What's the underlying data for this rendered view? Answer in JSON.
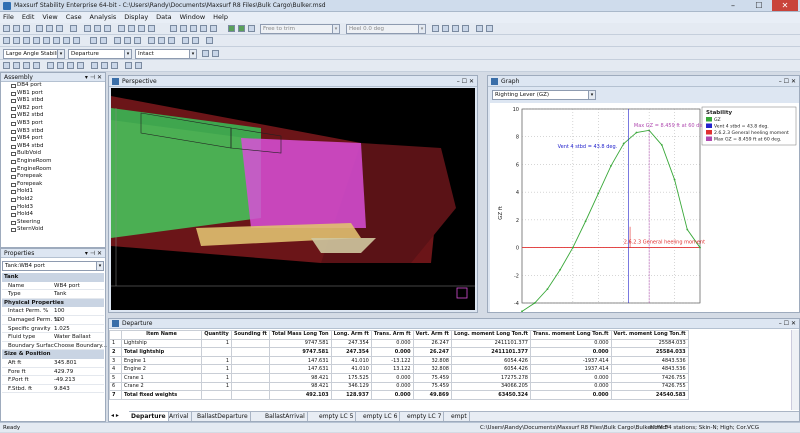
{
  "window": {
    "title": "Maxsurf Stability Enterprise 64-bit - C:\\Users\\Randy\\Documents\\Maxsurf R8 Files\\Bulk Cargo\\Bulker.msd",
    "min": "–",
    "max": "☐",
    "close": "✕"
  },
  "menu": [
    "File",
    "Edit",
    "View",
    "Case",
    "Analysis",
    "Display",
    "Data",
    "Window",
    "Help"
  ],
  "toolbar": {
    "free_to_trim": "Free to trim",
    "heel": "Heel 0.0 deg",
    "analysis_type": "Large Angle Stabili",
    "loadcase": "Departure",
    "condition": "Intact"
  },
  "assembly": {
    "title": "Assembly",
    "items": [
      "DB4 port",
      "WB1 port",
      "WB1 stbd",
      "WB2 port",
      "WB2 stbd",
      "WB3 port",
      "WB3 stbd",
      "WB4 port",
      "WB4 stbd",
      "BulbVoid",
      "EngineRoom",
      "EngineRoom",
      "Forepeak",
      "Forepeak",
      "Hold1",
      "Hold2",
      "Hold3",
      "Hold4",
      "Steering",
      "SternVoid"
    ]
  },
  "properties": {
    "title": "Properties",
    "selector": "Tank:WB4 port",
    "sections": [
      {
        "name": "Tank",
        "rows": [
          [
            "Name",
            "WB4 port"
          ],
          [
            "Type",
            "Tank"
          ]
        ]
      },
      {
        "name": "Physical Properties",
        "rows": [
          [
            "Intact Perm. %",
            "100"
          ],
          [
            "Damaged Perm. %",
            "100"
          ],
          [
            "Specific gravity",
            "1.025"
          ],
          [
            "Fluid type",
            "Water Ballast"
          ],
          [
            "Boundary Surfac",
            "Choose Boundary..."
          ]
        ]
      },
      {
        "name": "Size & Position",
        "rows": [
          [
            "Aft ft",
            "345.801"
          ],
          [
            "Fore ft",
            "429.79"
          ],
          [
            "F.Port ft",
            "-49.213"
          ],
          [
            "F.Stbd. ft",
            "9.843"
          ]
        ]
      }
    ]
  },
  "perspective": {
    "title": "Perspective"
  },
  "graph": {
    "title": "Graph",
    "selector": "Righting Lever (GZ)",
    "legend_title": "Stability",
    "legend": [
      {
        "label": "GZ",
        "color": "#39a839"
      },
      {
        "label": "Vent 4 stbd = 43.8 deg.",
        "color": "#2222cc"
      },
      {
        "label": "2.6.2.3 General heeling moment",
        "color": "#e03030"
      },
      {
        "label": "Max GZ = 8.459 ft at 60 deg.",
        "color": "#b04ab0"
      }
    ],
    "annotations": {
      "vent": "Vent 4 stbd = 43.8 deg.",
      "maxgz": "Max GZ = 8.459 ft at 60 deg.",
      "heeling": "2.6.2.3 General heeling moment"
    }
  },
  "chart_data": {
    "type": "line",
    "ylabel": "GZ  ft",
    "xlabel": "",
    "yticks": [
      10,
      8,
      6,
      4,
      2,
      0,
      -2,
      -4
    ],
    "ylim": [
      -4,
      10
    ],
    "xlim": [
      -40,
      100
    ],
    "series": [
      {
        "name": "GZ",
        "color": "#39a839",
        "x": [
          -40,
          -30,
          -20,
          -10,
          0,
          10,
          20,
          30,
          40,
          50,
          60,
          70,
          80,
          90,
          100
        ],
        "y": [
          -4.6,
          -4.0,
          -3.0,
          -1.6,
          0,
          1.9,
          3.9,
          5.9,
          7.5,
          8.3,
          8.46,
          7.4,
          4.9,
          1.3,
          0
        ]
      },
      {
        "name": "2.6.2.3 General heeling moment",
        "color": "#e03030",
        "x": [
          -40,
          100
        ],
        "y": [
          0,
          0
        ]
      }
    ],
    "markers": {
      "vent_x": 43.8,
      "maxgz_x": 60,
      "maxgz_y": 8.459
    }
  },
  "table": {
    "title": "Departure",
    "headers": [
      "",
      "Item Name",
      "Quantity",
      "Sounding ft",
      "Total Mass Long Ton",
      "Long. Arm ft",
      "Trans. Arm ft",
      "Vert. Arm ft",
      "Long. moment Long Ton.ft",
      "Trans. moment Long Ton.ft",
      "Vert. moment Long Ton.ft"
    ],
    "rows": [
      [
        "1",
        "Lightship",
        "1",
        "",
        "9747.581",
        "247.354",
        "0.000",
        "26.247",
        "2411101.377",
        "0.000",
        "25584.033"
      ],
      [
        "2",
        "Total lightship",
        "",
        "",
        "9747.581",
        "247.354",
        "0.000",
        "26.247",
        "2411101.377",
        "0.000",
        "25584.033"
      ],
      [
        "3",
        "Engine 1",
        "1",
        "",
        "147.631",
        "41.010",
        "-13.122",
        "32.808",
        "6054.426",
        "-1937.414",
        "4843.536"
      ],
      [
        "4",
        "Engine 2",
        "1",
        "",
        "147.631",
        "41.010",
        "13.122",
        "32.808",
        "6054.426",
        "1937.414",
        "4843.536"
      ],
      [
        "5",
        "Crane 1",
        "1",
        "",
        "98.421",
        "175.525",
        "0.000",
        "75.459",
        "17275.278",
        "0.000",
        "7426.755"
      ],
      [
        "6",
        "Crane 2",
        "1",
        "",
        "98.421",
        "346.129",
        "0.000",
        "75.459",
        "34066.205",
        "0.000",
        "7426.755"
      ],
      [
        "7",
        "Total fixed weights",
        "",
        "",
        "492.103",
        "128.937",
        "0.000",
        "49.869",
        "63450.324",
        "0.000",
        "24540.583"
      ]
    ],
    "tabs": [
      "Departure",
      "Arrival",
      "BallastDeparture",
      "BallastArrival",
      "empty LC 5",
      "empty LC 6",
      "empty LC 7",
      "empt"
    ]
  },
  "status": {
    "left": "Ready",
    "path": "C:\\Users\\Randy\\Documents\\Maxsurf R8 Files\\Bulk Cargo\\Bulker.msd*",
    "info": "NUM   54 stations; Skin-N; High; Cor.VCG"
  }
}
